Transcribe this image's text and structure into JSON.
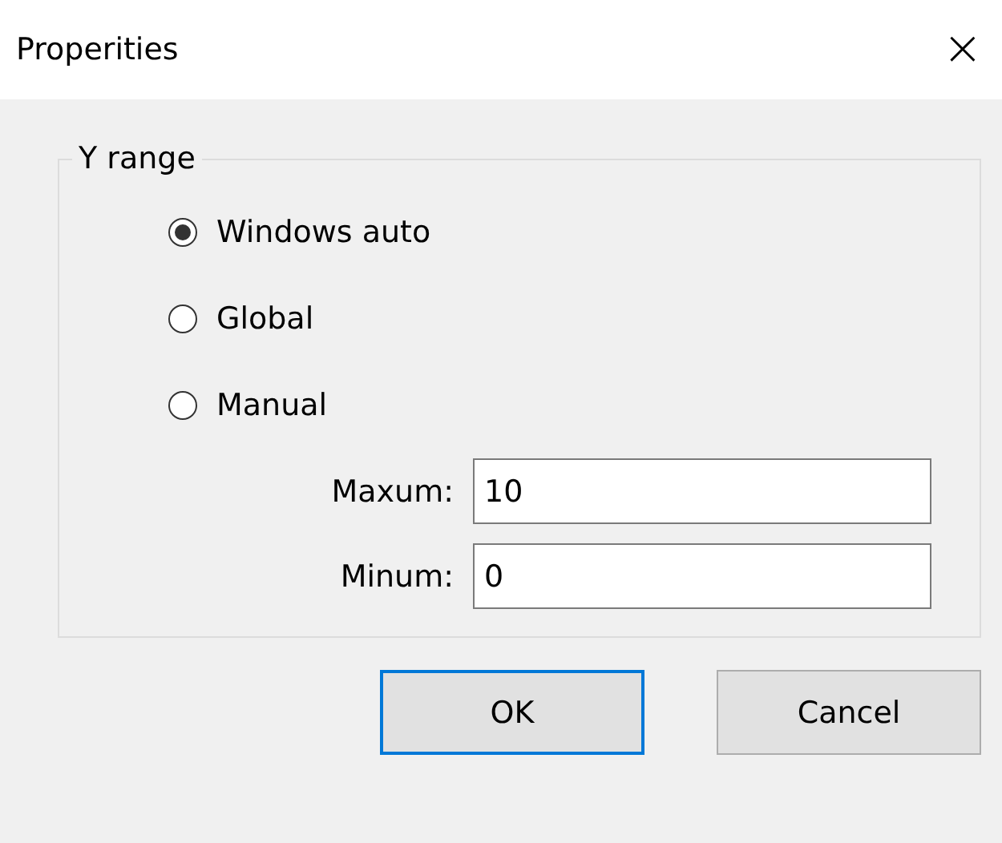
{
  "window": {
    "title": "Properities",
    "close": "×"
  },
  "group": {
    "title": "Y range",
    "options": [
      {
        "label": "Windows auto",
        "selected": true
      },
      {
        "label": "Global",
        "selected": false
      },
      {
        "label": "Manual",
        "selected": false
      }
    ],
    "fields": [
      {
        "label": "Maxum:",
        "value": "10"
      },
      {
        "label": "Minum:",
        "value": "0"
      }
    ]
  },
  "buttons": [
    {
      "label": "OK",
      "default": true
    },
    {
      "label": "Cancel",
      "default": false
    }
  ]
}
